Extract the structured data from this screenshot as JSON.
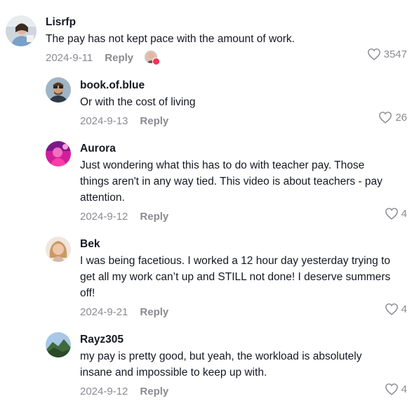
{
  "comments": [
    {
      "username": "Lisrfp",
      "text": "The pay has not kept pace with the amount of work.",
      "date": "2024-9-11",
      "reply_label": "Reply",
      "likes": "3547",
      "creator_liked": true
    },
    {
      "username": "book.of.blue",
      "text": "Or with the cost of living",
      "date": "2024-9-13",
      "reply_label": "Reply",
      "likes": "26"
    },
    {
      "username": "Aurora",
      "text_lines": [
        "Just wondering what this has to do with teacher pay. Those",
        "things aren't in any way tied. This video is about teachers - pay",
        "attention."
      ],
      "date": "2024-9-12",
      "reply_label": "Reply",
      "likes": "4"
    },
    {
      "username": "Bek",
      "text_lines": [
        "I was being facetious. I worked a 12 hour day yesterday trying to",
        "get all my work can’t up and STILL not done! I deserve summers",
        "off!"
      ],
      "date": "2024-9-21",
      "reply_label": "Reply",
      "likes": "4"
    },
    {
      "username": "Rayz305",
      "text_lines": [
        "my pay is pretty good, but yeah, the workload is absolutely",
        "insane and impossible to keep up with."
      ],
      "date": "2024-9-12",
      "reply_label": "Reply",
      "likes": "4"
    }
  ],
  "colors": {
    "text": "#161823",
    "muted": "#8a8b91",
    "heart_badge": "#fe2c55"
  },
  "icons": {
    "like": "heart-outline-icon",
    "creator_like": "creator-liked-badge-icon"
  }
}
